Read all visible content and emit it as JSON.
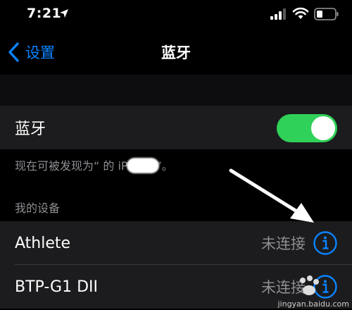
{
  "status_bar": {
    "time": "7:21"
  },
  "nav": {
    "back_label": "设置",
    "title": "蓝牙"
  },
  "bluetooth": {
    "label": "蓝牙",
    "enabled": true
  },
  "discoverable_note": "现在可被发现为“ 的 iPhone”。",
  "devices_header": "我的设备",
  "devices": [
    {
      "name": "Athlete",
      "status": "未连接"
    },
    {
      "name": "BTP-G1 DII",
      "status": "未连接"
    }
  ],
  "watermark": {
    "text": "jingyan.baidu.com"
  },
  "colors": {
    "accent": "#0a84ff",
    "toggle_on": "#30d158",
    "background": "#000000",
    "cell": "#1c1c1e",
    "secondary_text": "#8e8e93"
  },
  "icons": [
    "location-arrow-icon",
    "cellular-signal-icon",
    "wifi-icon",
    "battery-icon",
    "chevron-left-icon",
    "info-icon"
  ]
}
